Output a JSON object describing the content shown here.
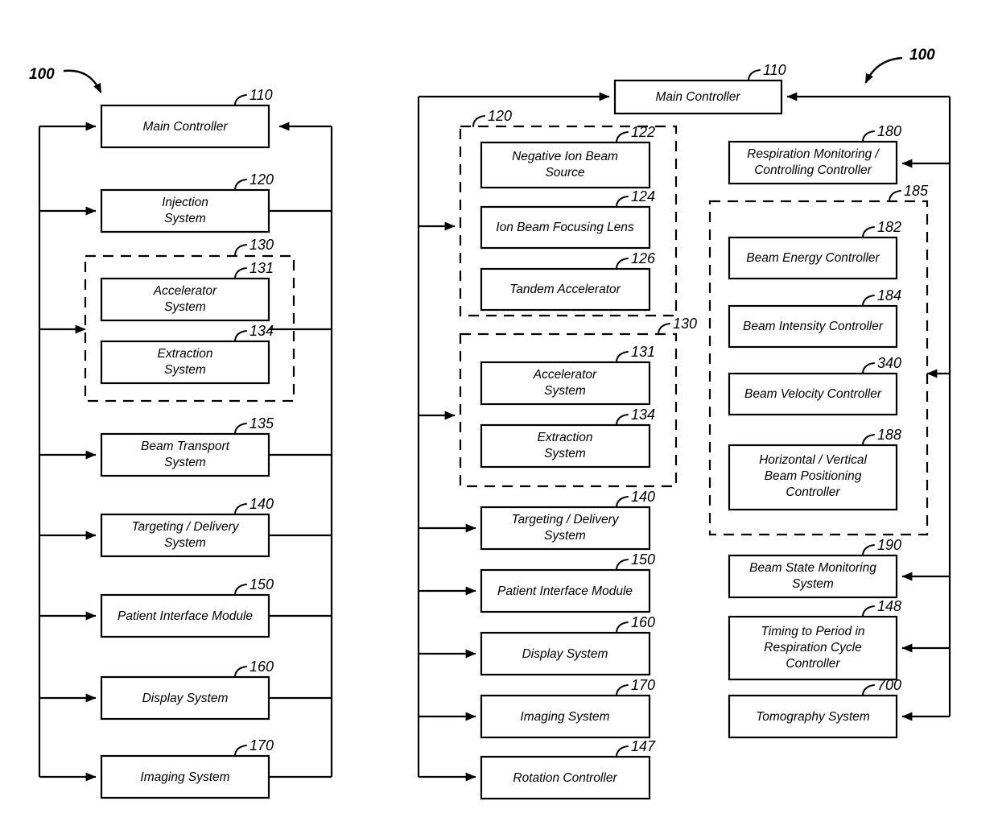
{
  "figure": {
    "figure_label_left": "100",
    "figure_label_right": "100"
  },
  "left_diagram": {
    "blocks": [
      {
        "ref": "110",
        "label_lines": [
          "Main Controller"
        ]
      },
      {
        "ref": "120",
        "label_lines": [
          "Injection",
          "System"
        ]
      },
      {
        "ref": "131",
        "label_lines": [
          "Accelerator",
          "System"
        ]
      },
      {
        "ref": "134",
        "label_lines": [
          "Extraction",
          "System"
        ]
      },
      {
        "ref": "135",
        "label_lines": [
          "Beam Transport",
          "System"
        ]
      },
      {
        "ref": "140",
        "label_lines": [
          "Targeting / Delivery",
          "System"
        ]
      },
      {
        "ref": "150",
        "label_lines": [
          "Patient Interface Module"
        ]
      },
      {
        "ref": "160",
        "label_lines": [
          "Display System"
        ]
      },
      {
        "ref": "170",
        "label_lines": [
          "Imaging System"
        ]
      }
    ],
    "groups": [
      {
        "ref": "130",
        "label": ""
      }
    ]
  },
  "middle_diagram": {
    "blocks": [
      {
        "ref": "110",
        "label_lines": [
          "Main Controller"
        ]
      },
      {
        "ref": "122",
        "label_lines": [
          "Negative Ion Beam",
          "Source"
        ]
      },
      {
        "ref": "124",
        "label_lines": [
          "Ion Beam Focusing Lens"
        ]
      },
      {
        "ref": "126",
        "label_lines": [
          "Tandem Accelerator"
        ]
      },
      {
        "ref": "131",
        "label_lines": [
          "Accelerator",
          "System"
        ]
      },
      {
        "ref": "134",
        "label_lines": [
          "Extraction",
          "System"
        ]
      },
      {
        "ref": "140",
        "label_lines": [
          "Targeting / Delivery",
          "System"
        ]
      },
      {
        "ref": "150",
        "label_lines": [
          "Patient Interface Module"
        ]
      },
      {
        "ref": "160",
        "label_lines": [
          "Display System"
        ]
      },
      {
        "ref": "170",
        "label_lines": [
          "Imaging System"
        ]
      },
      {
        "ref": "147",
        "label_lines": [
          "Rotation Controller"
        ]
      }
    ],
    "groups": [
      {
        "ref": "120",
        "label": ""
      },
      {
        "ref": "130",
        "label": ""
      }
    ]
  },
  "right_diagram": {
    "blocks": [
      {
        "ref": "180",
        "label_lines": [
          "Respiration Monitoring /",
          "Controlling Controller"
        ]
      },
      {
        "ref": "182",
        "label_lines": [
          "Beam Energy Controller"
        ]
      },
      {
        "ref": "184",
        "label_lines": [
          "Beam Intensity Controller"
        ]
      },
      {
        "ref": "340",
        "label_lines": [
          "Beam Velocity Controller"
        ]
      },
      {
        "ref": "188",
        "label_lines": [
          "Horizontal / Vertical",
          "Beam Positioning",
          "Controller"
        ]
      },
      {
        "ref": "190",
        "label_lines": [
          "Beam State Monitoring",
          "System"
        ]
      },
      {
        "ref": "148",
        "label_lines": [
          "Timing to Period in",
          "Respiration Cycle",
          "Controller"
        ]
      },
      {
        "ref": "700",
        "label_lines": [
          "Tomography System"
        ]
      }
    ],
    "groups": [
      {
        "ref": "185",
        "label": ""
      }
    ]
  },
  "colors": {
    "stroke": "#000000",
    "background": "#ffffff"
  }
}
